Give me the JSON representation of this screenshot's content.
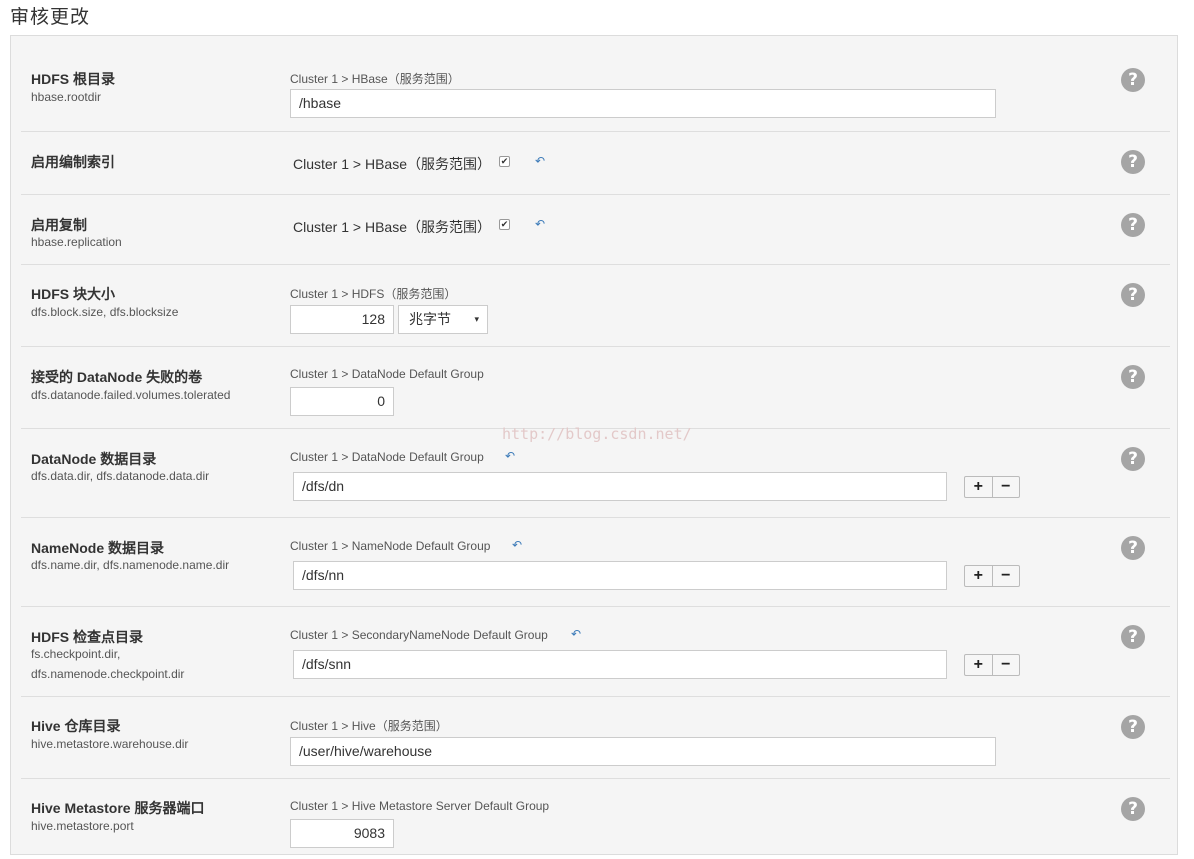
{
  "page_title": "审核更改",
  "watermark": "http://blog.csdn.net/",
  "revert_icon": "undo-arrow-icon",
  "help_icon": "question-circle-icon",
  "rows": [
    {
      "title": "HDFS 根目录",
      "key": "hbase.rootdir",
      "scope": "Cluster 1 > HBase（服务范围）",
      "value": "/hbase"
    },
    {
      "title": "启用编制索引",
      "scope": "Cluster 1 > HBase（服务范围）",
      "checked": true
    },
    {
      "title": "启用复制",
      "key": "hbase.replication",
      "scope": "Cluster 1 > HBase（服务范围）",
      "checked": true
    },
    {
      "title": "HDFS 块大小",
      "key": "dfs.block.size, dfs.blocksize",
      "scope": "Cluster 1 > HDFS（服务范围）",
      "value": "128",
      "unit": "兆字节"
    },
    {
      "title": "接受的 DataNode 失败的卷",
      "key": "dfs.datanode.failed.volumes.tolerated",
      "scope": "Cluster 1 > DataNode Default Group",
      "value": "0"
    },
    {
      "title": "DataNode 数据目录",
      "key": "dfs.data.dir, dfs.datanode.data.dir",
      "scope": "Cluster 1 > DataNode Default Group",
      "value": "/dfs/dn"
    },
    {
      "title": "NameNode 数据目录",
      "key": "dfs.name.dir, dfs.namenode.name.dir",
      "scope": "Cluster 1 > NameNode Default Group",
      "value": "/dfs/nn"
    },
    {
      "title": "HDFS 检查点目录",
      "key_line1": "fs.checkpoint.dir,",
      "key_line2": "dfs.namenode.checkpoint.dir",
      "scope": "Cluster 1 > SecondaryNameNode Default Group",
      "value": "/dfs/snn"
    },
    {
      "title": "Hive 仓库目录",
      "key": "hive.metastore.warehouse.dir",
      "scope": "Cluster 1 > Hive（服务范围）",
      "value": "/user/hive/warehouse"
    },
    {
      "title": "Hive Metastore 服务器端口",
      "key": "hive.metastore.port",
      "scope": "Cluster 1 > Hive Metastore Server Default Group",
      "value": "9083"
    }
  ],
  "add_button_label": "+",
  "remove_button_label": "−",
  "select_arrow": "▾",
  "checkmark": "✔",
  "help_glyph": "?",
  "revert_glyph": "↶"
}
